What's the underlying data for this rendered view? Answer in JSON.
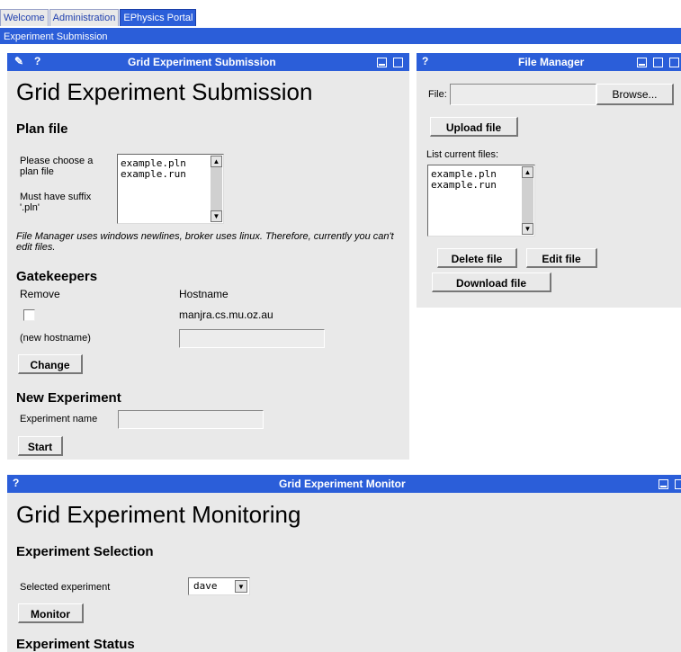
{
  "tabs": [
    "Welcome",
    "Administration",
    "EPhysics Portal"
  ],
  "portal_bar": "Experiment Submission",
  "submission": {
    "title_bar": "Grid Experiment Submission",
    "heading": "Grid Experiment Submission",
    "plan_heading": "Plan file",
    "choose_label": "Please choose a plan file",
    "suffix_label": "Must have suffix '.pln'",
    "files": [
      "example.pln",
      "example.run"
    ],
    "note": "File Manager uses windows newlines, broker uses linux. Therefore, currently you can't edit files.",
    "gatekeepers_heading": "Gatekeepers",
    "col_remove": "Remove",
    "col_hostname": "Hostname",
    "host": "manjra.cs.mu.oz.au",
    "new_hostname_label": "(new hostname)",
    "change_button": "Change",
    "new_experiment_heading": "New Experiment",
    "experiment_name_label": "Experiment name",
    "start_button": "Start"
  },
  "file_manager": {
    "title_bar": "File Manager",
    "file_label": "File:",
    "browse_button": "Browse...",
    "upload_button": "Upload file",
    "list_label": "List current files:",
    "files": [
      "example.pln",
      "example.run"
    ],
    "delete_button": "Delete file",
    "edit_button": "Edit file",
    "download_button": "Download file"
  },
  "monitor": {
    "title_bar": "Grid Experiment Monitor",
    "heading": "Grid Experiment Monitoring",
    "selection_heading": "Experiment Selection",
    "selected_label": "Selected experiment",
    "selected_value": "dave",
    "monitor_button": "Monitor",
    "status_heading": "Experiment Status"
  },
  "colors": {
    "titlebar": "#2b5ed9",
    "panel": "#e9e9e9"
  },
  "icons": [
    "pencil-icon",
    "help-icon",
    "minimize-icon",
    "maximize-icon",
    "close-icon"
  ]
}
